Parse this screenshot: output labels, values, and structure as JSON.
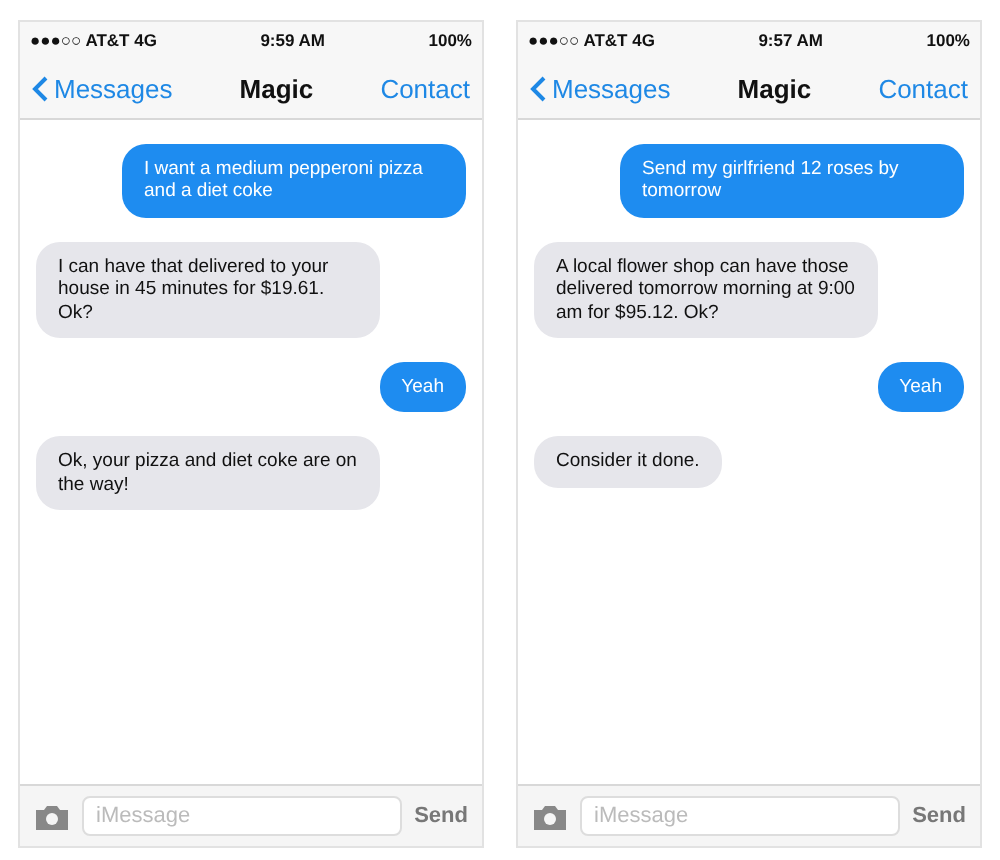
{
  "phones": [
    {
      "status": {
        "carrier": "●●●○○ AT&T 4G",
        "time": "9:59 AM",
        "battery": "100%"
      },
      "nav": {
        "back": "Messages",
        "title": "Magic",
        "action": "Contact"
      },
      "messages": [
        {
          "kind": "sent",
          "text": "I want a medium pepperoni pizza and a diet coke"
        },
        {
          "kind": "received",
          "text": "I can have that delivered to your house in 45 minutes for $19.61. Ok?"
        },
        {
          "kind": "sent",
          "text": "Yeah"
        },
        {
          "kind": "received",
          "text": "Ok, your pizza and diet coke are on the way!"
        }
      ],
      "input": {
        "placeholder": "iMessage",
        "send": "Send"
      }
    },
    {
      "status": {
        "carrier": "●●●○○ AT&T 4G",
        "time": "9:57 AM",
        "battery": "100%"
      },
      "nav": {
        "back": "Messages",
        "title": "Magic",
        "action": "Contact"
      },
      "messages": [
        {
          "kind": "sent",
          "text": "Send my girlfriend 12 roses by tomorrow"
        },
        {
          "kind": "received",
          "text": "A local flower shop can have those delivered tomorrow morning at 9:00 am for $95.12. Ok?"
        },
        {
          "kind": "sent",
          "text": "Yeah"
        },
        {
          "kind": "received",
          "text": "Consider it done."
        }
      ],
      "input": {
        "placeholder": "iMessage",
        "send": "Send"
      }
    }
  ]
}
